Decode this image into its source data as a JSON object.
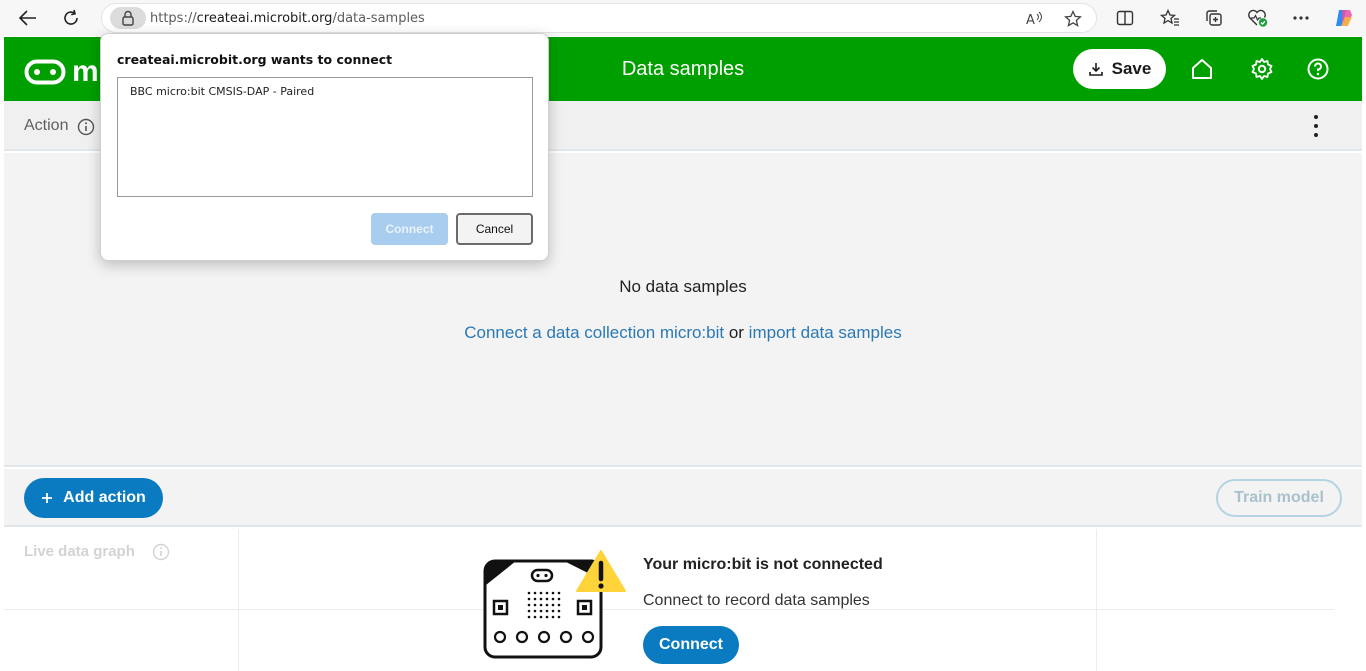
{
  "browser": {
    "url_prefix": "https://",
    "url_host": "createai.microbit.org",
    "url_path": "/data-samples"
  },
  "header": {
    "logo_text": "mi",
    "title": "Data samples",
    "save_label": "Save",
    "brand_color": "#009f00"
  },
  "subheader": {
    "action_label": "Action"
  },
  "samples": {
    "empty_text": "No data samples",
    "connect_link": "Connect a data collection micro:bit",
    "or_text": " or ",
    "import_link": "import data samples"
  },
  "actions": {
    "add_action_label": "Add action",
    "train_model_label": "Train model"
  },
  "graph": {
    "label": "Live data graph",
    "status_title": "Your micro:bit is not connected",
    "status_subtitle": "Connect to record data samples",
    "connect_label": "Connect"
  },
  "dialog": {
    "title": "createai.microbit.org wants to connect",
    "devices": [
      "BBC micro:bit CMSIS-DAP - Paired"
    ],
    "connect_label": "Connect",
    "cancel_label": "Cancel"
  },
  "colors": {
    "accent_blue": "#0a7bc1",
    "link_blue": "#2a79b4",
    "warning_yellow": "#ffd43b"
  }
}
